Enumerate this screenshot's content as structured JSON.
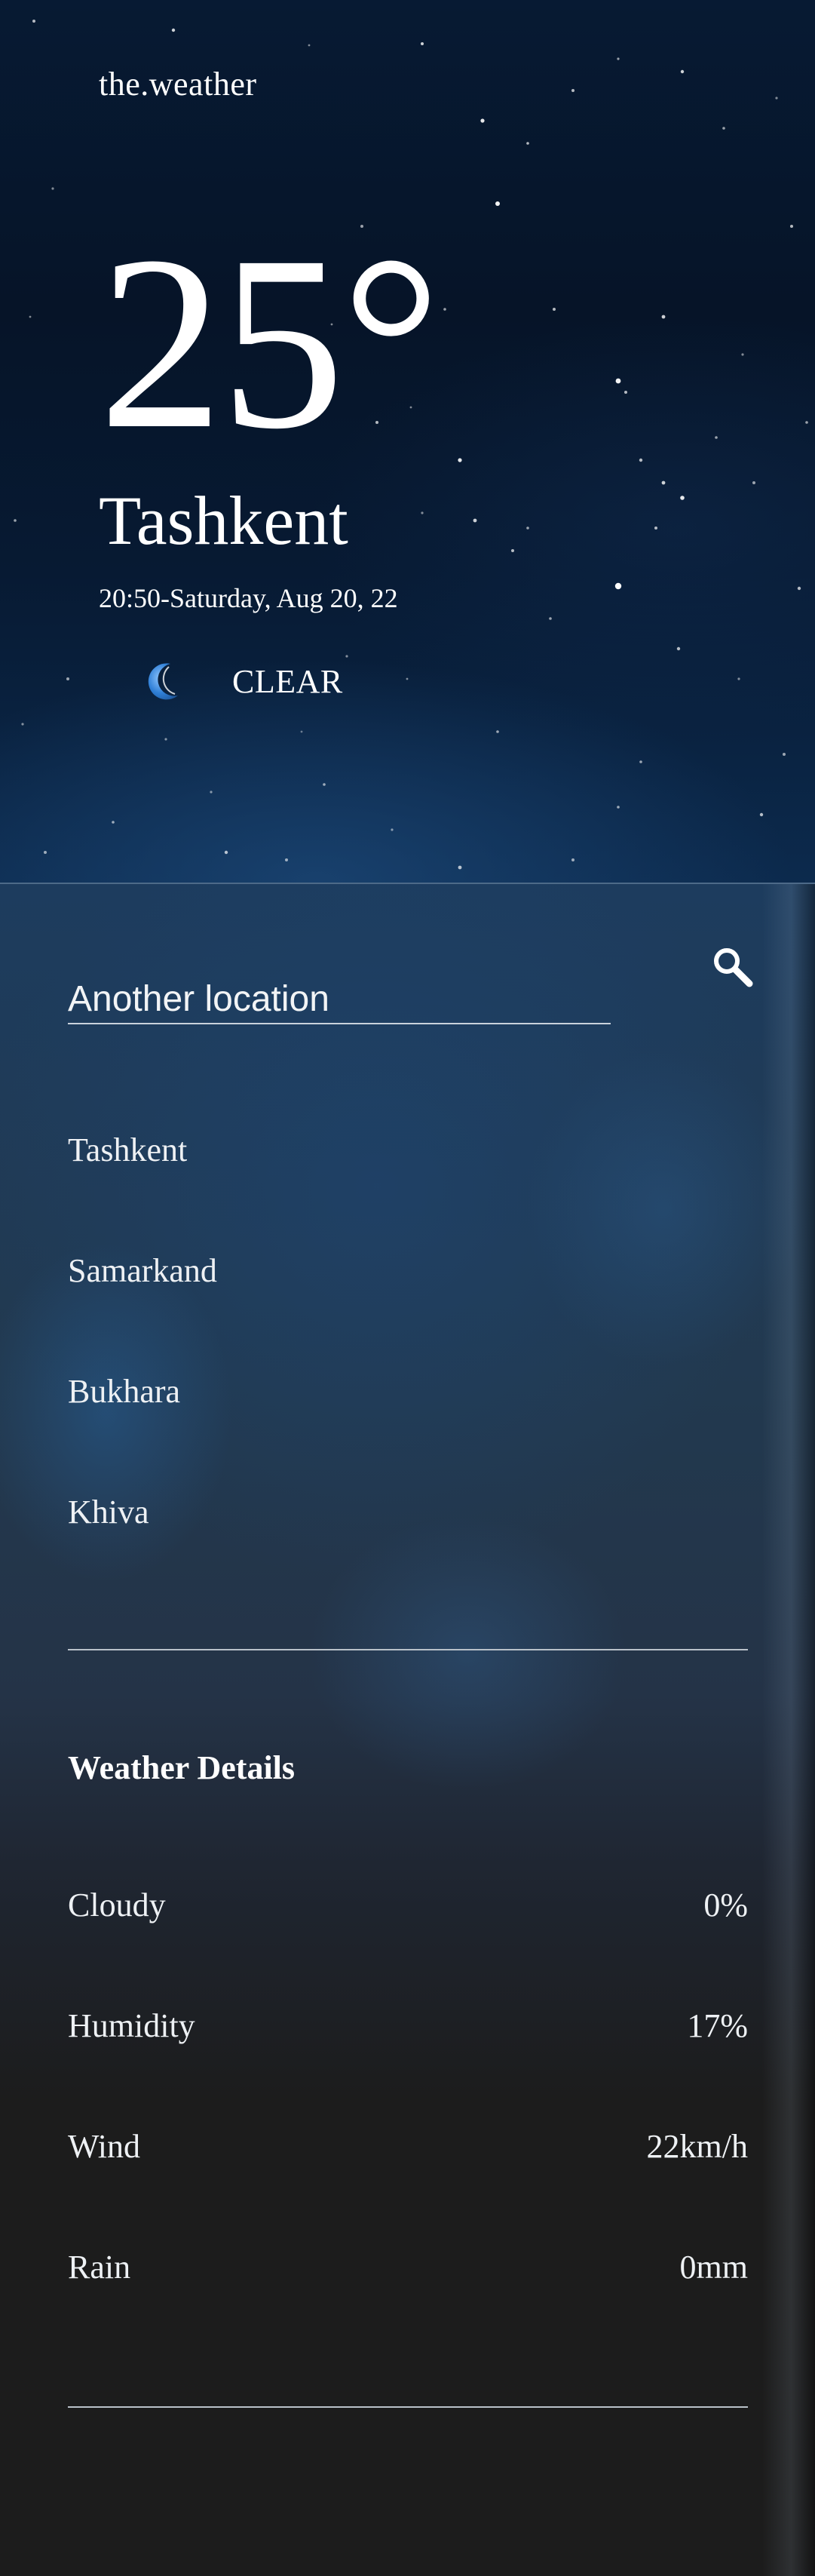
{
  "app": {
    "brand": "the.weather"
  },
  "current": {
    "temperature": "25°",
    "city": "Tashkent",
    "datetime": "20:50-Saturday, Aug 20, 22",
    "condition": "CLEAR",
    "condition_icon": "moon-icon"
  },
  "search": {
    "placeholder": "Another location",
    "button_icon": "search-icon"
  },
  "locations": [
    "Tashkent",
    "Samarkand",
    "Bukhara",
    "Khiva"
  ],
  "details": {
    "title": "Weather Details",
    "rows": [
      {
        "label": "Cloudy",
        "value": "0%"
      },
      {
        "label": "Humidity",
        "value": "17%"
      },
      {
        "label": "Wind",
        "value": "22km/h"
      },
      {
        "label": "Rain",
        "value": "0mm"
      }
    ]
  },
  "colors": {
    "sky_top": "#061428",
    "sky_bottom": "#0c2a4d",
    "panel_dark": "#1c1c1c",
    "moon": "#2f7fd6"
  }
}
